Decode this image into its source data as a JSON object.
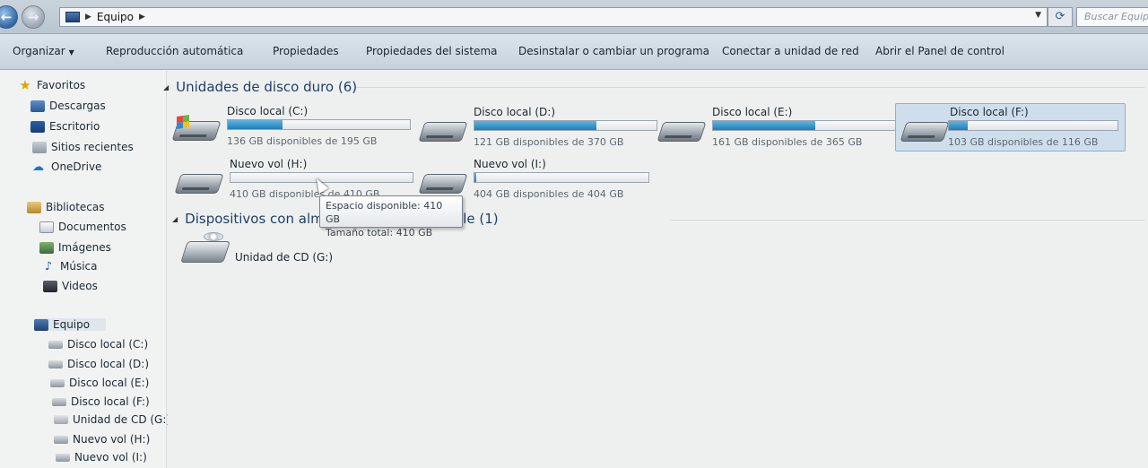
{
  "address": {
    "crumbs": [
      "Equipo"
    ],
    "search_placeholder": "Buscar Equipo"
  },
  "toolbar": {
    "organize": "Organizar",
    "autoplay": "Reproducción automática",
    "properties": "Propiedades",
    "system_properties": "Propiedades del sistema",
    "uninstall": "Desinstalar o cambiar un programa",
    "map_drive": "Conectar a unidad de red",
    "control_panel": "Abrir el Panel de control"
  },
  "nav": {
    "favorites": {
      "title": "Favoritos",
      "items": [
        "Descargas",
        "Escritorio",
        "Sitios recientes"
      ]
    },
    "onedrive": "OneDrive",
    "libraries": {
      "title": "Bibliotecas",
      "items": [
        "Documentos",
        "Imágenes",
        "Música",
        "Videos"
      ]
    },
    "computer": {
      "title": "Equipo",
      "items": [
        "Disco local (C:)",
        "Disco local (D:)",
        "Disco local (E:)",
        "Disco local (F:)",
        "Unidad de CD (G:)",
        "Nuevo vol (H:)",
        "Nuevo vol (I:)"
      ]
    }
  },
  "hard_drives": {
    "header": "Unidades de disco duro (6)",
    "drives": [
      {
        "name": "Disco local (C:)",
        "free": "136 GB disponibles de 195 GB",
        "used_fraction": 0.3
      },
      {
        "name": "Disco local (D:)",
        "free": "121 GB disponibles de 370 GB",
        "used_fraction": 0.67
      },
      {
        "name": "Disco local (E:)",
        "free": "161 GB disponibles de 365 GB",
        "used_fraction": 0.56
      },
      {
        "name": "Disco local (F:)",
        "free": "103 GB disponibles de 116 GB",
        "used_fraction": 0.11
      },
      {
        "name": "Nuevo vol (H:)",
        "free": "410 GB disponibles de 410 GB",
        "used_fraction": 0.0
      },
      {
        "name": "Nuevo vol (I:)",
        "free": "404 GB disponibles de 404 GB",
        "used_fraction": 0.01
      }
    ]
  },
  "removable": {
    "header": "Dispositivos con almacenamiento extraíble (1)",
    "items": [
      {
        "name": "Unidad de CD (G:)"
      }
    ]
  },
  "tooltip": {
    "line1": "Espacio disponible: 410 GB",
    "line2": "Tamaño total: 410 GB"
  }
}
